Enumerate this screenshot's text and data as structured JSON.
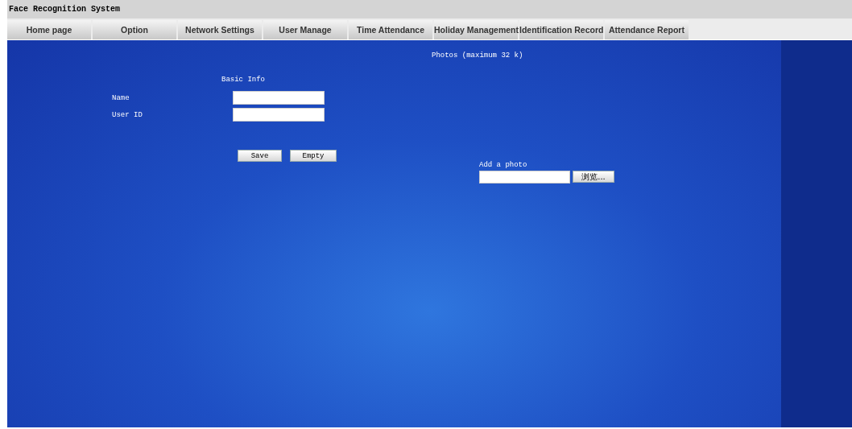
{
  "window": {
    "title": "Face Recognition System"
  },
  "tabs": [
    {
      "label": "Home page",
      "selected": false
    },
    {
      "label": "Option",
      "selected": false
    },
    {
      "label": "Network Settings",
      "selected": false
    },
    {
      "label": "User Manage",
      "selected": false
    },
    {
      "label": "Time Attendance",
      "selected": false
    },
    {
      "label": "Holiday Management",
      "selected": false
    },
    {
      "label": "Identification Record",
      "selected": false
    },
    {
      "label": "Attendance Report",
      "selected": false
    }
  ],
  "basic_info": {
    "heading": "Basic Info",
    "fields": [
      {
        "label": "Name"
      },
      {
        "label": "User ID"
      }
    ],
    "buttons": [
      "Save",
      "Empty"
    ]
  },
  "photos": {
    "heading": "Photos (maximum 32 k)",
    "add_label": "Add a photo",
    "browse_button": "浏览..."
  }
}
